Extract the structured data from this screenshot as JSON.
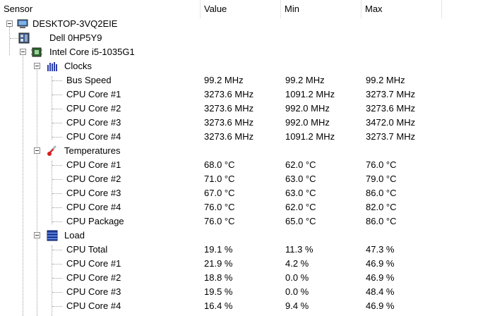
{
  "columns": {
    "sensor": "Sensor",
    "value": "Value",
    "min": "Min",
    "max": "Max"
  },
  "computer": {
    "label": "DESKTOP-3VQ2EIE",
    "icon": "computer-icon"
  },
  "motherboard": {
    "label": "Dell 0HP5Y9",
    "icon": "motherboard-icon"
  },
  "cpu": {
    "label": "Intel Core i5-1035G1",
    "icon": "cpu-chip-icon"
  },
  "groups": {
    "clocks": {
      "label": "Clocks",
      "icon": "clock-bars-icon",
      "rows": [
        {
          "name": "Bus Speed",
          "value": "99.2 MHz",
          "min": "99.2 MHz",
          "max": "99.2 MHz"
        },
        {
          "name": "CPU Core #1",
          "value": "3273.6 MHz",
          "min": "1091.2 MHz",
          "max": "3273.7 MHz"
        },
        {
          "name": "CPU Core #2",
          "value": "3273.6 MHz",
          "min": "992.0 MHz",
          "max": "3273.6 MHz"
        },
        {
          "name": "CPU Core #3",
          "value": "3273.6 MHz",
          "min": "992.0 MHz",
          "max": "3472.0 MHz"
        },
        {
          "name": "CPU Core #4",
          "value": "3273.6 MHz",
          "min": "1091.2 MHz",
          "max": "3273.7 MHz"
        }
      ]
    },
    "temperatures": {
      "label": "Temperatures",
      "icon": "thermometer-icon",
      "rows": [
        {
          "name": "CPU Core #1",
          "value": "68.0 °C",
          "min": "62.0 °C",
          "max": "76.0 °C"
        },
        {
          "name": "CPU Core #2",
          "value": "71.0 °C",
          "min": "63.0 °C",
          "max": "79.0 °C"
        },
        {
          "name": "CPU Core #3",
          "value": "67.0 °C",
          "min": "63.0 °C",
          "max": "86.0 °C"
        },
        {
          "name": "CPU Core #4",
          "value": "76.0 °C",
          "min": "62.0 °C",
          "max": "82.0 °C"
        },
        {
          "name": "CPU Package",
          "value": "76.0 °C",
          "min": "65.0 °C",
          "max": "86.0 °C"
        }
      ]
    },
    "load": {
      "label": "Load",
      "icon": "load-bars-icon",
      "rows": [
        {
          "name": "CPU Total",
          "value": "19.1 %",
          "min": "11.3 %",
          "max": "47.3 %"
        },
        {
          "name": "CPU Core #1",
          "value": "21.9 %",
          "min": "4.2 %",
          "max": "46.9 %"
        },
        {
          "name": "CPU Core #2",
          "value": "18.8 %",
          "min": "0.0 %",
          "max": "46.9 %"
        },
        {
          "name": "CPU Core #3",
          "value": "19.5 %",
          "min": "0.0 %",
          "max": "48.4 %"
        },
        {
          "name": "CPU Core #4",
          "value": "16.4 %",
          "min": "9.4 %",
          "max": "46.9 %"
        }
      ]
    }
  }
}
